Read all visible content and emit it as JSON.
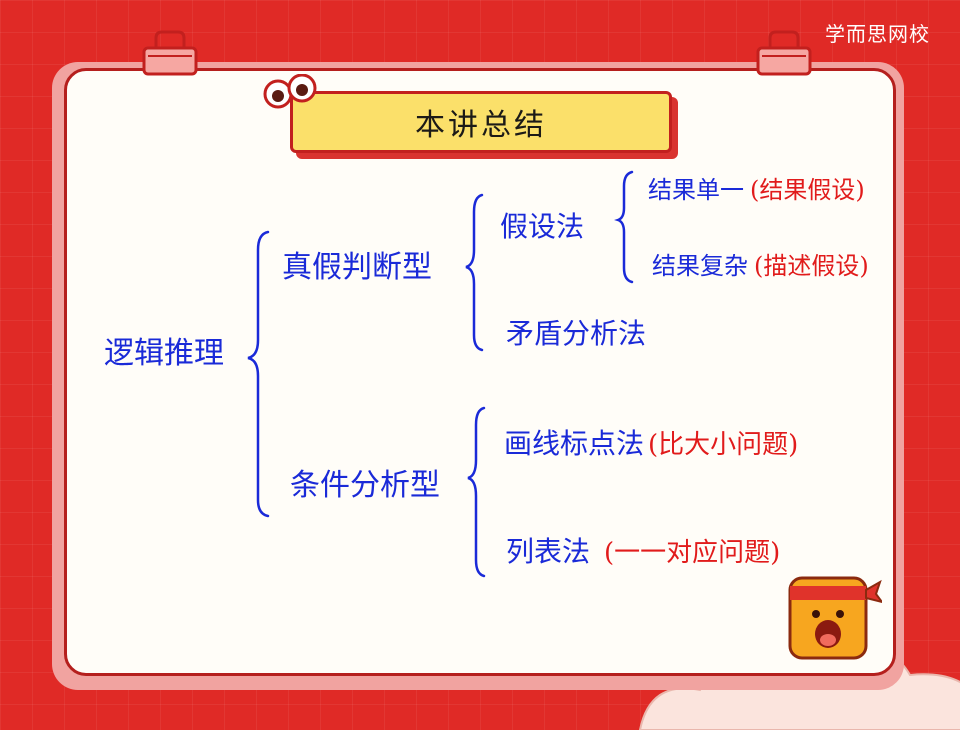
{
  "brand": "学而思网校",
  "title": "本讲总结",
  "mindmap": {
    "root": "逻辑推理",
    "branch1": {
      "label": "真假判断型",
      "sub1": {
        "label": "假设法",
        "leaf1": {
          "label": "结果单一",
          "note": "(结果假设)"
        },
        "leaf2": {
          "label": "结果复杂",
          "note": "(描述假设)"
        }
      },
      "sub2": {
        "label": "矛盾分析法"
      }
    },
    "branch2": {
      "label": "条件分析型",
      "sub1": {
        "label": "画线标点法",
        "note": "(比大小问题)"
      },
      "sub2": {
        "label": "列表法",
        "note": "(一一对应问题)"
      }
    }
  },
  "colors": {
    "background": "#e02a26",
    "board": "#fffdf8",
    "ink_blue": "#1a2ad8",
    "ink_red": "#e11b1b",
    "banner": "#fbe06a"
  },
  "icons": {
    "clips": "binder-clip-icon",
    "eyes": "googly-eyes-icon",
    "mascot": "mascot-icon"
  }
}
